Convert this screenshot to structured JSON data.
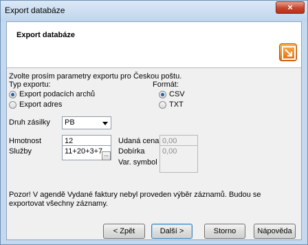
{
  "window": {
    "title": "Export databáze",
    "close_label": "×"
  },
  "header": {
    "title": "Export databáze",
    "icon": "export-icon"
  },
  "intro": "Zvolte prosím parametry exportu pro Českou poštu.",
  "export_type": {
    "label": "Typ exportu:",
    "options": [
      {
        "label": "Export podacích archů",
        "selected": true
      },
      {
        "label": "Export adres",
        "selected": false
      }
    ]
  },
  "format": {
    "label": "Formát:",
    "options": [
      {
        "label": "CSV",
        "selected": true
      },
      {
        "label": "TXT",
        "selected": false
      }
    ]
  },
  "druh_zasilky": {
    "label": "Druh zásilky",
    "value": "PB"
  },
  "hmotnost": {
    "label": "Hmotnost",
    "value": "12"
  },
  "sluzby": {
    "label": "Služby",
    "value": "11+20+3+7",
    "button": "..."
  },
  "udana_cena": {
    "label": "Udaná cena",
    "value": "0,00"
  },
  "dobirka": {
    "label": "Dobírka",
    "value": "0,00"
  },
  "var_symbol": {
    "label": "Var. symbol",
    "value": ""
  },
  "warning": "Pozor! V agendě Vydané faktury nebyl proveden výběr záznamů. Budou se exportovat všechny záznamy.",
  "buttons": {
    "back": "< Zpět",
    "next": "Další >",
    "cancel": "Storno",
    "help": "Nápověda"
  }
}
